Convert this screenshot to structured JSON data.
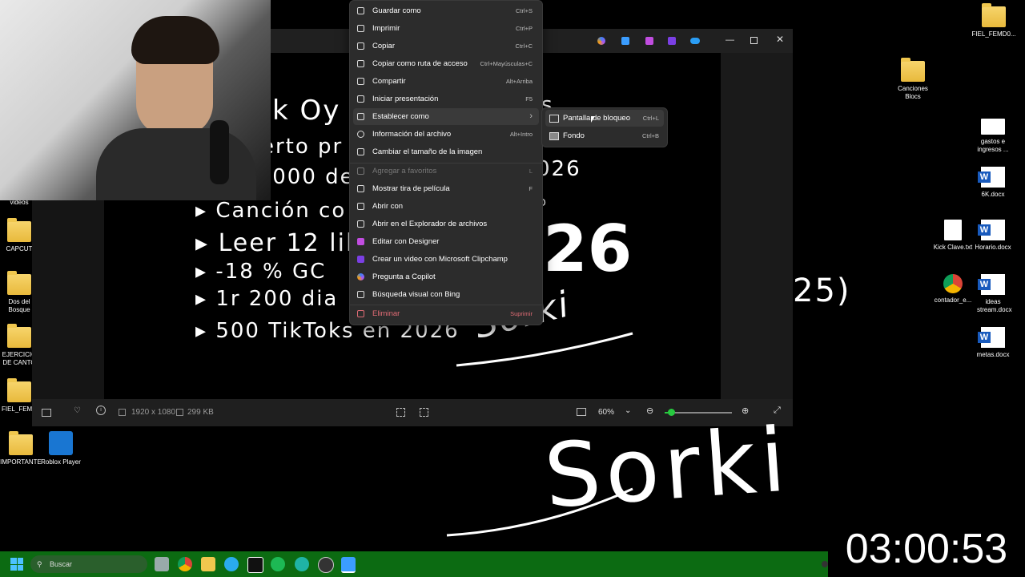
{
  "desktop": {
    "icons_left": [
      {
        "label": "videos"
      },
      {
        "label": "CAPCUT"
      },
      {
        "label": "Dos del Bosque"
      },
      {
        "label": "EJERCICIO DE CANTO"
      },
      {
        "label": "FIEL_FEMD"
      },
      {
        "label": "IMPORTANTE"
      },
      {
        "label": "Roblox Player"
      }
    ],
    "icons_right": [
      {
        "label": "FIEL_FEMD0..."
      },
      {
        "label": "Canciones Blocs"
      },
      {
        "label": "gastos e ingresos ..."
      },
      {
        "label": "6K.docx"
      },
      {
        "label": "Kick Clave.txt"
      },
      {
        "label": "Horario.docx"
      },
      {
        "label": "contador_e..."
      },
      {
        "label": "ideas stream.docx"
      },
      {
        "label": "metas.docx"
      }
    ]
  },
  "handwriting": {
    "line1": "k Oy",
    "line1b": "s",
    "line2": "erto pr",
    "line3": ",000 de",
    "line3b": "026",
    "line4": "▸ Canción co",
    "line4b": "to",
    "line5": "▸ Leer 12 lib",
    "line6": "▸ -18 % GC",
    "line7": "▸ 1r 200 dia",
    "line8": "▸ 500 TikToks en 2026",
    "big_year": "26",
    "paren": "25)",
    "signature_small": "Sorki",
    "signature_large": "Sorki"
  },
  "statusbar": {
    "dimensions": "1920 x 1080",
    "size": "299 KB",
    "zoom": "60%",
    "zoom_level": 0.1
  },
  "context_menu": {
    "items": [
      {
        "label": "Guardar como",
        "shortcut": "Ctrl+S"
      },
      {
        "label": "Imprimir",
        "shortcut": "Ctrl+P"
      },
      {
        "label": "Copiar",
        "shortcut": "Ctrl+C"
      },
      {
        "label": "Copiar como ruta de acceso",
        "shortcut": "Ctrl+Mayúsculas+C"
      },
      {
        "label": "Compartir",
        "shortcut": "Alt+Arriba"
      },
      {
        "label": "Iniciar presentación",
        "shortcut": "F5"
      },
      {
        "label": "Establecer como",
        "shortcut": "›"
      },
      {
        "label": "Información del archivo",
        "shortcut": "Alt+Intro"
      },
      {
        "label": "Cambiar el tamaño de la imagen",
        "shortcut": ""
      },
      {
        "label": "Agregar a favoritos",
        "shortcut": "L"
      },
      {
        "label": "Mostrar tira de película",
        "shortcut": "F"
      },
      {
        "label": "Abrir con",
        "shortcut": ""
      },
      {
        "label": "Abrir en el Explorador de archivos",
        "shortcut": ""
      },
      {
        "label": "Editar con Designer",
        "shortcut": ""
      },
      {
        "label": "Crear un video con Microsoft Clipchamp",
        "shortcut": ""
      },
      {
        "label": "Pregunta a Copilot",
        "shortcut": ""
      },
      {
        "label": "Búsqueda visual con Bing",
        "shortcut": ""
      },
      {
        "label": "Eliminar",
        "shortcut": "Suprimir"
      }
    ],
    "submenu": [
      {
        "label": "Pantalla de bloqueo",
        "shortcut": "Ctrl+L"
      },
      {
        "label": "Fondo",
        "shortcut": "Ctrl+B"
      }
    ]
  },
  "taskbar": {
    "search_placeholder": "Buscar"
  },
  "timer": "03:00:53",
  "colors": {
    "taskbar": "#0c6b12",
    "menu_bg": "#2c2c2c",
    "danger": "#e06c75",
    "zoom_thumb": "#27c93f"
  }
}
